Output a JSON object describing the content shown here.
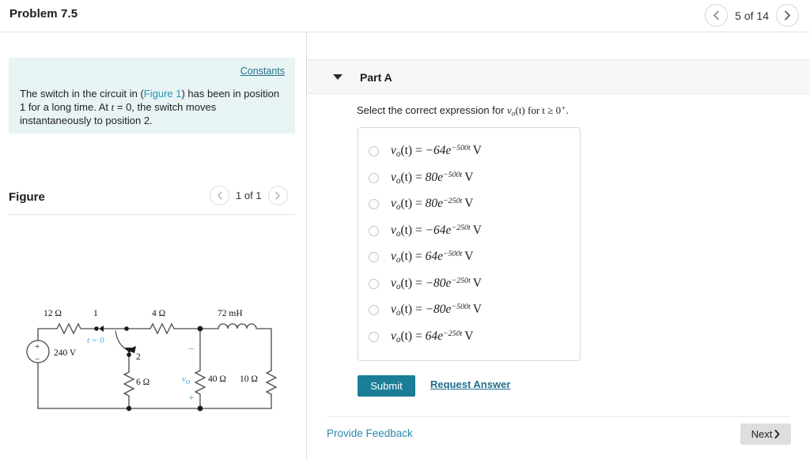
{
  "header": {
    "problem_title": "Problem 7.5",
    "counter": "5 of 14",
    "prev_icon": "chevron-left-icon",
    "next_icon": "chevron-right-icon"
  },
  "left": {
    "constants_link": "Constants",
    "statement_part1": "The switch in the circuit in (",
    "statement_figlink": "Figure 1",
    "statement_part2": ") has been in position 1 for a long time. At ",
    "statement_t": "t",
    "statement_part3": " = 0, the switch moves instantaneously to position 2.",
    "figure_title": "Figure",
    "figure_counter": "1 of 1",
    "panel_bg": "#e8f4f4"
  },
  "figure": {
    "source_label": "240 V",
    "r12": "12 Ω",
    "r6": "6 Ω",
    "r4": "4 Ω",
    "r40": "40 Ω",
    "r10": "10 Ω",
    "inductor": "72 mH",
    "switch_pos1": "1",
    "switch_pos2": "2",
    "switch_time": "t = 0",
    "vo_label": "v",
    "vo_sub": "o",
    "polarity_minus": "−",
    "polarity_plus": "+",
    "source_plus": "+",
    "source_minus": "−",
    "accent_color": "#4aa8dd"
  },
  "part_a": {
    "caret_icon": "caret-down-icon",
    "label": "Part A",
    "question_pre": "Select the correct expression for ",
    "question_var": "v",
    "question_var_sub": "o",
    "question_mid": "(t) for ",
    "question_t": "t ≥ 0",
    "question_sup": "+",
    "question_end": ".",
    "options": [
      {
        "lhs": "v",
        "sub": "o",
        "arg": "(t) = ",
        "coef": "−64e",
        "exp": "−500t",
        "unit": "V"
      },
      {
        "lhs": "v",
        "sub": "o",
        "arg": "(t) = ",
        "coef": "80e",
        "exp": "−500t",
        "unit": "V"
      },
      {
        "lhs": "v",
        "sub": "o",
        "arg": "(t) = ",
        "coef": "80e",
        "exp": "−250t",
        "unit": "V"
      },
      {
        "lhs": "v",
        "sub": "o",
        "arg": "(t) = ",
        "coef": "−64e",
        "exp": "−250t",
        "unit": "V"
      },
      {
        "lhs": "v",
        "sub": "o",
        "arg": "(t) = ",
        "coef": "64e",
        "exp": "−500t",
        "unit": "V"
      },
      {
        "lhs": "v",
        "sub": "o",
        "arg": "(t) = ",
        "coef": "−80e",
        "exp": "−250t",
        "unit": "V"
      },
      {
        "lhs": "v",
        "sub": "o",
        "arg": "(t) = ",
        "coef": "−80e",
        "exp": "−500t",
        "unit": "V"
      },
      {
        "lhs": "v",
        "sub": "o",
        "arg": "(t) = ",
        "coef": "64e",
        "exp": "−250t",
        "unit": "V"
      }
    ],
    "submit_label": "Submit",
    "request_answer_label": "Request Answer",
    "submit_color": "#1b7d96"
  },
  "footer": {
    "provide_feedback": "Provide Feedback",
    "next_label": "Next",
    "next_icon": "chevron-right-icon"
  }
}
